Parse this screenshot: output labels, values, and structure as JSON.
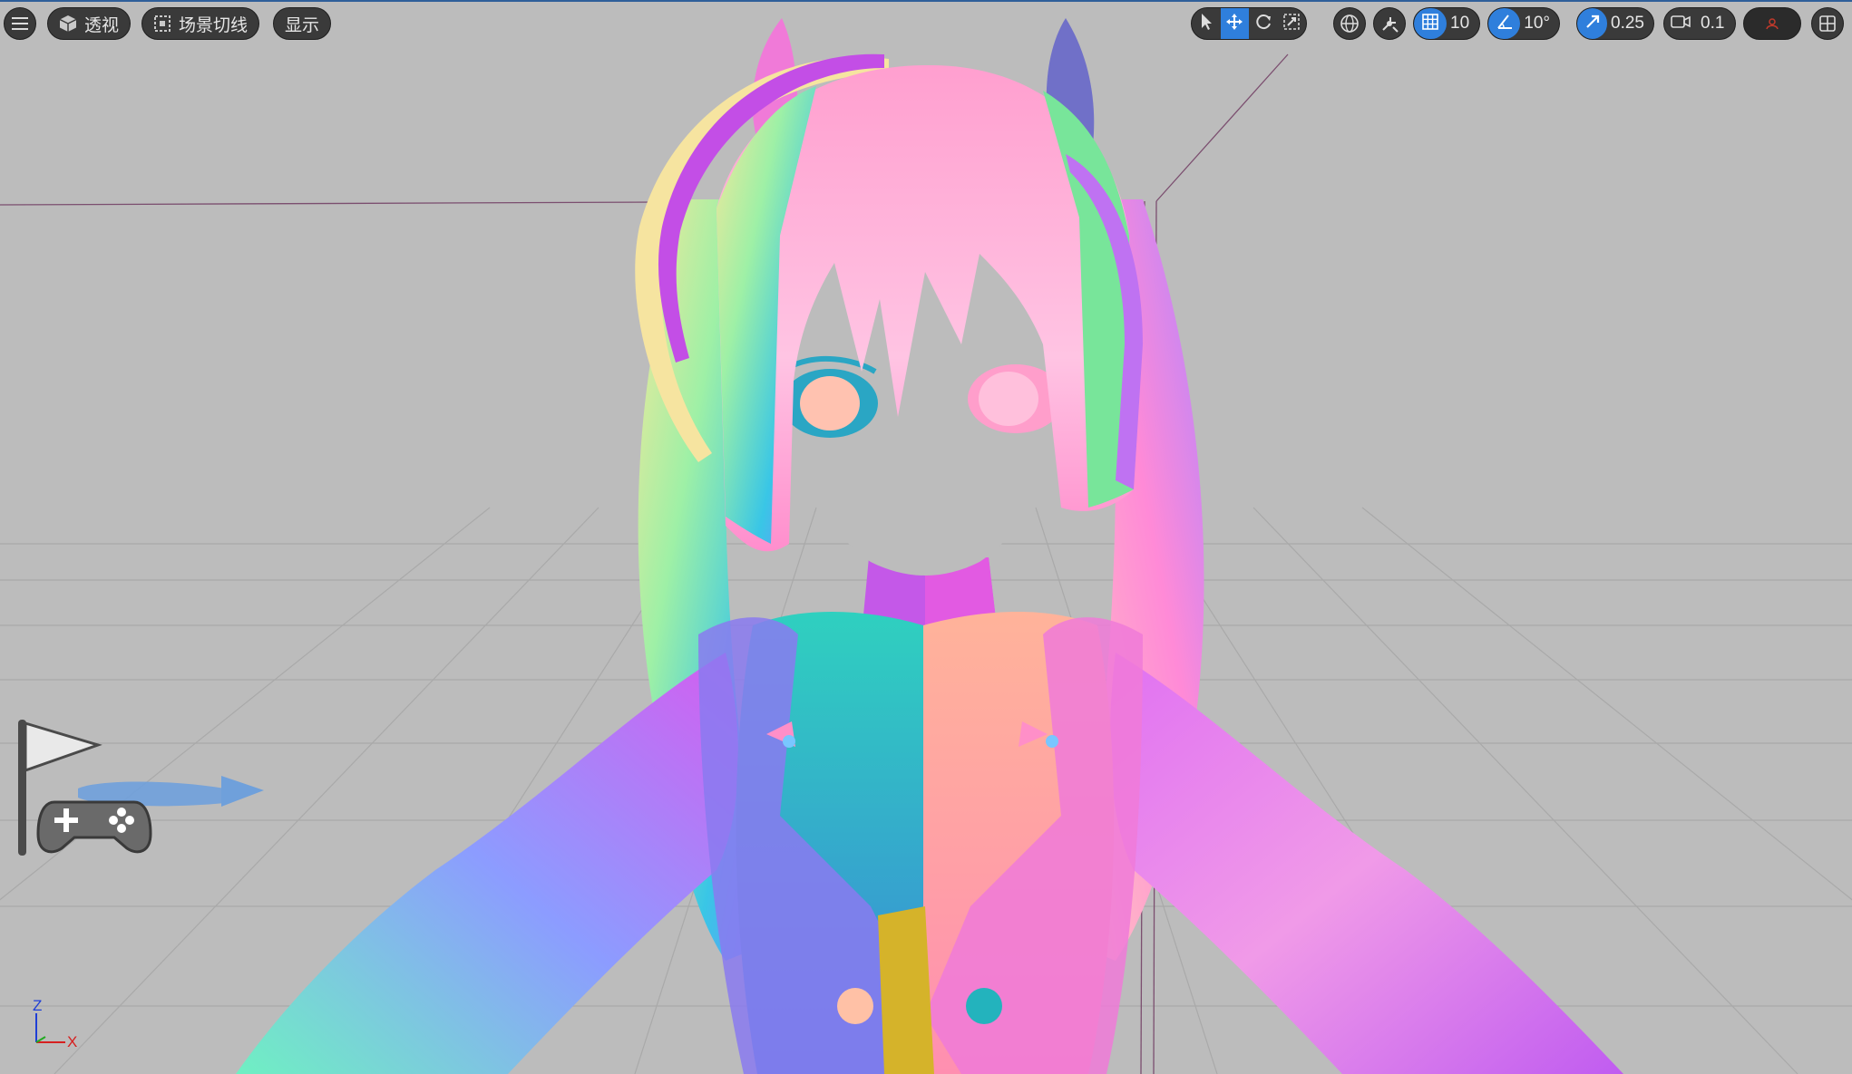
{
  "toolbar": {
    "menu_icon": "hamburger-icon",
    "perspective_label": "透视",
    "scene_cut_label": "场景切线",
    "display_label": "显示",
    "grid_snap_value": "10",
    "angle_snap_value": "10°",
    "scale_snap_value": "0.25",
    "camera_speed_value": "0.1",
    "colors": {
      "active": "#2f7fdc",
      "pill_bg": "#3a3a3a"
    }
  },
  "viewport": {
    "background": "#bcbcbc",
    "axes": {
      "z_label": "Z",
      "x_label": "X"
    }
  }
}
